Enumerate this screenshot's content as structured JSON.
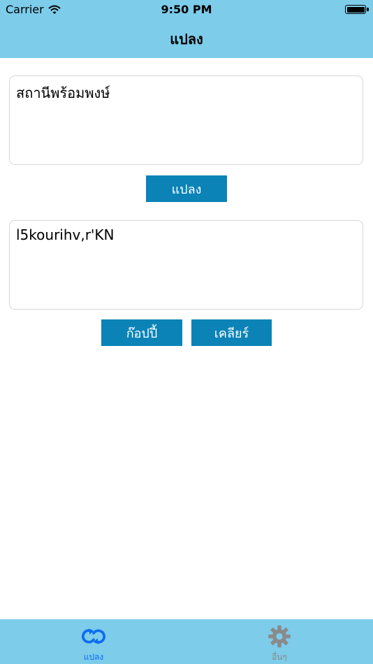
{
  "status_bar": {
    "carrier": "Carrier",
    "time": "9:50 PM"
  },
  "nav": {
    "title": "แปลง"
  },
  "input_box": {
    "value": "สถานีพร้อมพงษ์"
  },
  "convert_button": {
    "label": "แปลง"
  },
  "output_box": {
    "value": "l5kourihv,r'KN"
  },
  "copy_button": {
    "label": "ก๊อปปี้"
  },
  "clear_button": {
    "label": "เคลียร์"
  },
  "tab_bar": {
    "tabs": [
      {
        "label": "แปลง",
        "icon": "convert-arrows-icon",
        "active": true
      },
      {
        "label": "อื่นๆ",
        "icon": "gear-icon",
        "active": false
      }
    ]
  },
  "colors": {
    "header_bg": "#7cccea",
    "button_bg": "#0b83b7",
    "active_tab": "#0c6cf0",
    "inactive_tab": "#8a8a8a"
  }
}
